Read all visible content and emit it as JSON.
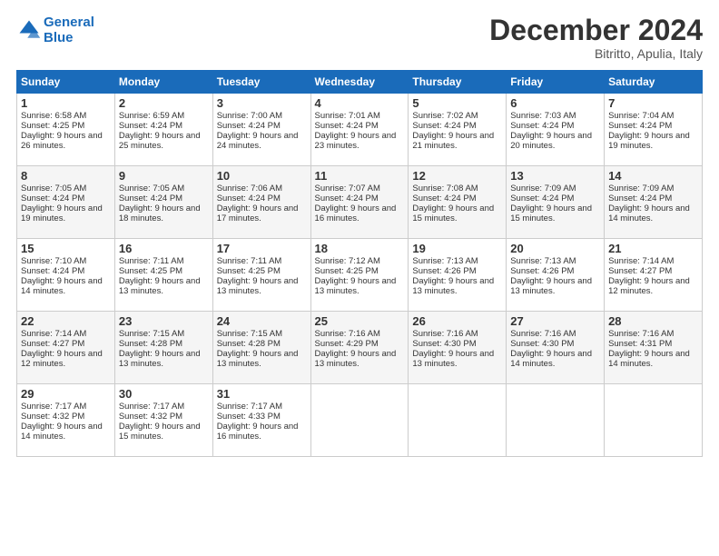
{
  "header": {
    "logo_line1": "General",
    "logo_line2": "Blue",
    "month_title": "December 2024",
    "location": "Bitritto, Apulia, Italy"
  },
  "days_of_week": [
    "Sunday",
    "Monday",
    "Tuesday",
    "Wednesday",
    "Thursday",
    "Friday",
    "Saturday"
  ],
  "weeks": [
    [
      {
        "day": "1",
        "sunrise": "6:58 AM",
        "sunset": "4:25 PM",
        "daylight": "9 hours and 26 minutes."
      },
      {
        "day": "2",
        "sunrise": "6:59 AM",
        "sunset": "4:24 PM",
        "daylight": "9 hours and 25 minutes."
      },
      {
        "day": "3",
        "sunrise": "7:00 AM",
        "sunset": "4:24 PM",
        "daylight": "9 hours and 24 minutes."
      },
      {
        "day": "4",
        "sunrise": "7:01 AM",
        "sunset": "4:24 PM",
        "daylight": "9 hours and 23 minutes."
      },
      {
        "day": "5",
        "sunrise": "7:02 AM",
        "sunset": "4:24 PM",
        "daylight": "9 hours and 21 minutes."
      },
      {
        "day": "6",
        "sunrise": "7:03 AM",
        "sunset": "4:24 PM",
        "daylight": "9 hours and 20 minutes."
      },
      {
        "day": "7",
        "sunrise": "7:04 AM",
        "sunset": "4:24 PM",
        "daylight": "9 hours and 19 minutes."
      }
    ],
    [
      {
        "day": "8",
        "sunrise": "7:05 AM",
        "sunset": "4:24 PM",
        "daylight": "9 hours and 19 minutes."
      },
      {
        "day": "9",
        "sunrise": "7:05 AM",
        "sunset": "4:24 PM",
        "daylight": "9 hours and 18 minutes."
      },
      {
        "day": "10",
        "sunrise": "7:06 AM",
        "sunset": "4:24 PM",
        "daylight": "9 hours and 17 minutes."
      },
      {
        "day": "11",
        "sunrise": "7:07 AM",
        "sunset": "4:24 PM",
        "daylight": "9 hours and 16 minutes."
      },
      {
        "day": "12",
        "sunrise": "7:08 AM",
        "sunset": "4:24 PM",
        "daylight": "9 hours and 15 minutes."
      },
      {
        "day": "13",
        "sunrise": "7:09 AM",
        "sunset": "4:24 PM",
        "daylight": "9 hours and 15 minutes."
      },
      {
        "day": "14",
        "sunrise": "7:09 AM",
        "sunset": "4:24 PM",
        "daylight": "9 hours and 14 minutes."
      }
    ],
    [
      {
        "day": "15",
        "sunrise": "7:10 AM",
        "sunset": "4:24 PM",
        "daylight": "9 hours and 14 minutes."
      },
      {
        "day": "16",
        "sunrise": "7:11 AM",
        "sunset": "4:25 PM",
        "daylight": "9 hours and 13 minutes."
      },
      {
        "day": "17",
        "sunrise": "7:11 AM",
        "sunset": "4:25 PM",
        "daylight": "9 hours and 13 minutes."
      },
      {
        "day": "18",
        "sunrise": "7:12 AM",
        "sunset": "4:25 PM",
        "daylight": "9 hours and 13 minutes."
      },
      {
        "day": "19",
        "sunrise": "7:13 AM",
        "sunset": "4:26 PM",
        "daylight": "9 hours and 13 minutes."
      },
      {
        "day": "20",
        "sunrise": "7:13 AM",
        "sunset": "4:26 PM",
        "daylight": "9 hours and 13 minutes."
      },
      {
        "day": "21",
        "sunrise": "7:14 AM",
        "sunset": "4:27 PM",
        "daylight": "9 hours and 12 minutes."
      }
    ],
    [
      {
        "day": "22",
        "sunrise": "7:14 AM",
        "sunset": "4:27 PM",
        "daylight": "9 hours and 12 minutes."
      },
      {
        "day": "23",
        "sunrise": "7:15 AM",
        "sunset": "4:28 PM",
        "daylight": "9 hours and 13 minutes."
      },
      {
        "day": "24",
        "sunrise": "7:15 AM",
        "sunset": "4:28 PM",
        "daylight": "9 hours and 13 minutes."
      },
      {
        "day": "25",
        "sunrise": "7:16 AM",
        "sunset": "4:29 PM",
        "daylight": "9 hours and 13 minutes."
      },
      {
        "day": "26",
        "sunrise": "7:16 AM",
        "sunset": "4:30 PM",
        "daylight": "9 hours and 13 minutes."
      },
      {
        "day": "27",
        "sunrise": "7:16 AM",
        "sunset": "4:30 PM",
        "daylight": "9 hours and 14 minutes."
      },
      {
        "day": "28",
        "sunrise": "7:16 AM",
        "sunset": "4:31 PM",
        "daylight": "9 hours and 14 minutes."
      }
    ],
    [
      {
        "day": "29",
        "sunrise": "7:17 AM",
        "sunset": "4:32 PM",
        "daylight": "9 hours and 14 minutes."
      },
      {
        "day": "30",
        "sunrise": "7:17 AM",
        "sunset": "4:32 PM",
        "daylight": "9 hours and 15 minutes."
      },
      {
        "day": "31",
        "sunrise": "7:17 AM",
        "sunset": "4:33 PM",
        "daylight": "9 hours and 16 minutes."
      },
      null,
      null,
      null,
      null
    ]
  ],
  "labels": {
    "sunrise": "Sunrise:",
    "sunset": "Sunset:",
    "daylight": "Daylight:"
  }
}
